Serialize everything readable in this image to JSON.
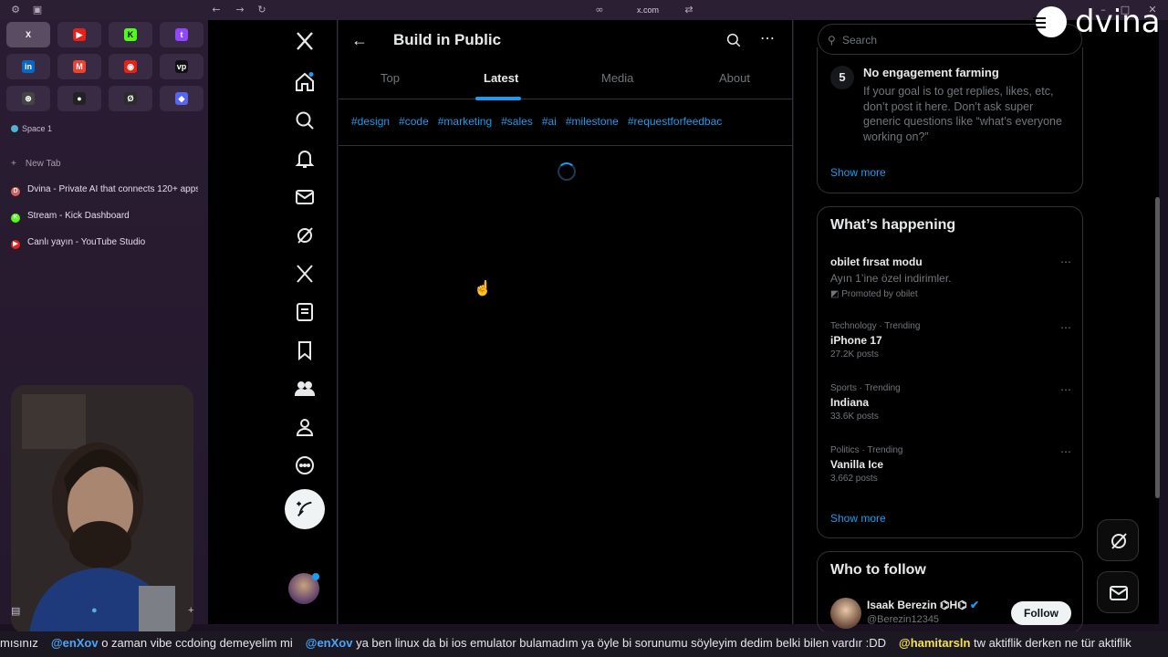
{
  "browser": {
    "url": "x.com",
    "favorites": [
      {
        "glyph": "X",
        "color": "#5a4d63",
        "text": "#ffffff"
      },
      {
        "glyph": "▶",
        "color": "#e62117",
        "text": "#ffffff"
      },
      {
        "glyph": "K",
        "color": "#53fc18",
        "text": "#000000"
      },
      {
        "glyph": "t",
        "color": "#9146ff",
        "text": "#ffffff"
      },
      {
        "glyph": "in",
        "color": "#0a66c2",
        "text": "#ffffff"
      },
      {
        "glyph": "M",
        "color": "#ea4335",
        "text": "#ffffff"
      },
      {
        "glyph": "◉",
        "color": "#e62117",
        "text": "#ffffff"
      },
      {
        "glyph": "vp",
        "color": "#111111",
        "text": "#ffffff"
      },
      {
        "glyph": "⊛",
        "color": "#444444",
        "text": "#ffffff"
      },
      {
        "glyph": "●",
        "color": "#222222",
        "text": "#ffffff"
      },
      {
        "glyph": "Ø",
        "color": "#2b2b2b",
        "text": "#ffffff"
      },
      {
        "glyph": "◆",
        "color": "#5865f2",
        "text": "#ffffff"
      }
    ],
    "space_label": "Space 1",
    "new_tab_label": "New Tab",
    "tabs": [
      {
        "title": "Dvina - Private AI that connects 120+ apps...",
        "color": "#e05a5a",
        "glyph": "D"
      },
      {
        "title": "Stream - Kick Dashboard",
        "color": "#53fc18",
        "glyph": "K"
      },
      {
        "title": "Canlı yayın - YouTube Studio",
        "color": "#e62117",
        "glyph": "▶"
      }
    ]
  },
  "feed": {
    "title": "Build in Public",
    "tabs": [
      "Top",
      "Latest",
      "Media",
      "About"
    ],
    "selected_tab": "Latest",
    "hashtags": [
      "#design",
      "#code",
      "#marketing",
      "#sales",
      "#ai",
      "#milestone",
      "#requestforfeedbac"
    ]
  },
  "right": {
    "search_placeholder": "Search",
    "rule_number": "5",
    "rule_title": "No engagement farming",
    "rule_text": "If your goal is to get replies, likes, etc, don’t post it here. Don’t ask super generic questions like “what’s everyone working on?”",
    "show_more": "Show more",
    "happening_title": "What’s happening",
    "promo": {
      "name": "obilet fırsat modu",
      "desc": "Ayın 1’ine özel indirimler.",
      "promoted": "Promoted by obilet"
    },
    "trends": [
      {
        "meta": "Technology · Trending",
        "name": "iPhone 17",
        "count": "27.2K posts"
      },
      {
        "meta": "Sports · Trending",
        "name": "Indiana",
        "count": "33.6K posts"
      },
      {
        "meta": "Politics · Trending",
        "name": "Vanilla Ice",
        "count": "3,662 posts"
      }
    ],
    "who_title": "Who to follow",
    "follow_name": "Isaak Berezin ⌬H⌬",
    "follow_handle": "@Berezin12345",
    "follow_button": "Follow"
  },
  "overlay": {
    "brand": "dvina"
  },
  "ticker": [
    {
      "user": "",
      "text": "mısınız"
    },
    {
      "user": "@enXov",
      "text": "o zaman vibe ccdoing demeyelim mi"
    },
    {
      "user": "@enXov",
      "text": "ya ben linux da bi ios emulator bulamadım ya öyle bi sorunumu söyleyim dedim belki bilen vardır :DD"
    },
    {
      "user": "@hamitarsln",
      "text": "tw aktiflik derken ne tür aktiflik",
      "highlight": true
    }
  ]
}
